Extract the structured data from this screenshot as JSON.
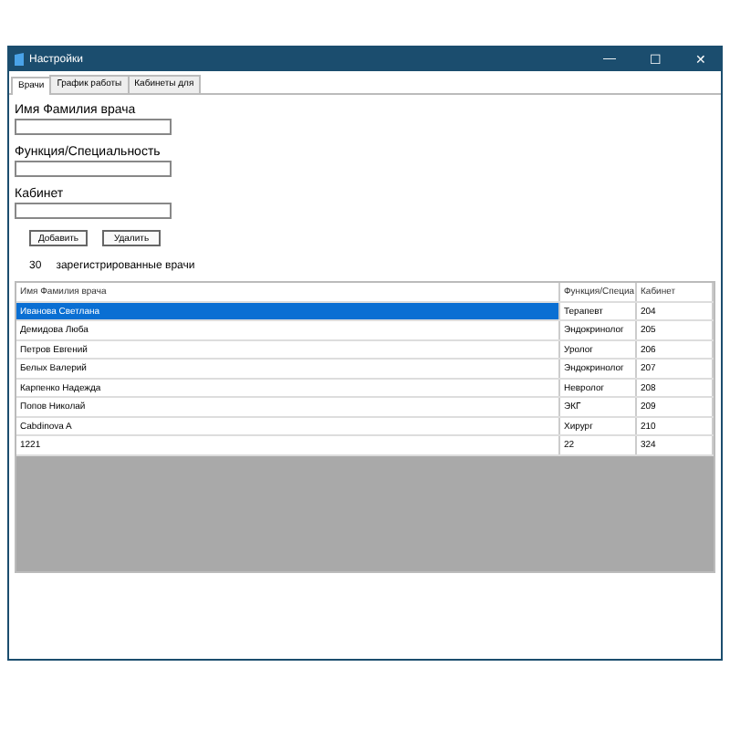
{
  "window": {
    "title": "Настройки",
    "controls": [
      "—",
      "☐",
      "✕"
    ]
  },
  "tabs": [
    {
      "label": "Врачи",
      "selected": true
    },
    {
      "label": "График работы",
      "selected": false
    },
    {
      "label": "Кабинеты для",
      "selected": false
    }
  ],
  "form": {
    "fields": [
      {
        "label": "Имя Фамилия врача"
      },
      {
        "label": "Функция/Специальность"
      },
      {
        "label": "Кабинет"
      }
    ],
    "buttons": [
      "Добавить",
      "Удалить"
    ],
    "count": "30",
    "count_label": "зарегистрированные врачи"
  },
  "table": {
    "columns": [
      "Имя Фамилия врача",
      "Функция/Специа",
      "Кабинет"
    ],
    "rows": [
      {
        "cells": [
          "Иванова Светлана",
          "Терапевт",
          "204"
        ],
        "selected": true
      },
      {
        "cells": [
          "Демидова Люба",
          "Эндокринолог",
          "205"
        ],
        "selected": false
      },
      {
        "cells": [
          "Петров Евгений",
          "Уролог",
          "206"
        ],
        "selected": false
      },
      {
        "cells": [
          "Белых Валерий",
          "Эндокринолог",
          "207"
        ],
        "selected": false
      },
      {
        "cells": [
          "Карпенко Надежда",
          "Невролог",
          "208"
        ],
        "selected": false
      },
      {
        "cells": [
          "Попов Николай",
          "ЭКГ",
          "209"
        ],
        "selected": false
      },
      {
        "cells": [
          "Cabdinova A",
          "Хирург",
          "210"
        ],
        "selected": false
      },
      {
        "cells": [
          "1221",
          "22",
          "324"
        ],
        "selected": false
      }
    ]
  }
}
